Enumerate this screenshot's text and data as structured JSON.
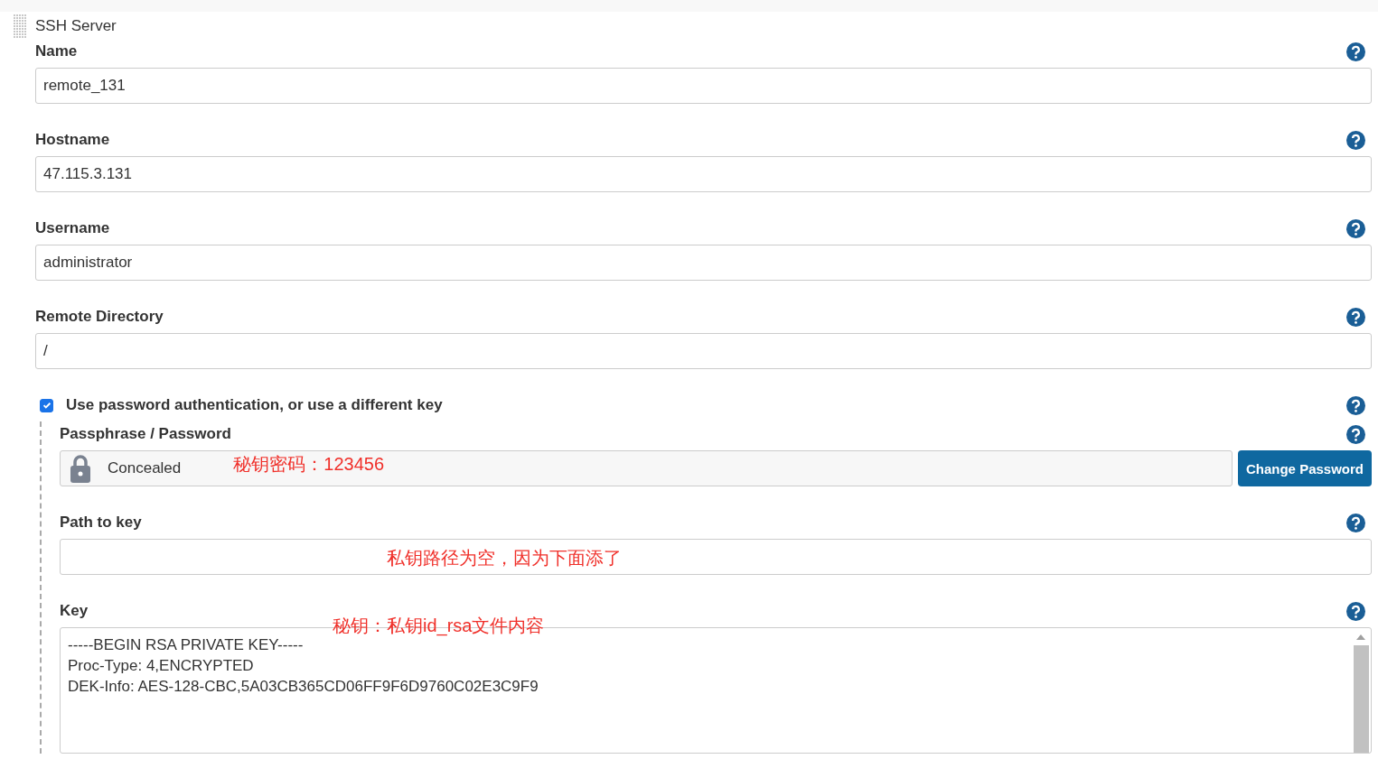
{
  "section": {
    "title": "SSH Server"
  },
  "fields": [
    {
      "label": "Name",
      "value": "remote_131"
    },
    {
      "label": "Hostname",
      "value": "47.115.3.131"
    },
    {
      "label": "Username",
      "value": "administrator"
    },
    {
      "label": "Remote Directory",
      "value": "/"
    }
  ],
  "password_auth": {
    "label": "Use password authentication, or use a different key",
    "checked": true,
    "passphrase": {
      "label": "Passphrase / Password",
      "value": "Concealed",
      "button": "Change Password",
      "annotation": "秘钥密码：123456"
    },
    "path_to_key": {
      "label": "Path to key",
      "annotation": "私钥路径为空，因为下面添了"
    },
    "key": {
      "label": "Key",
      "annotation": "秘钥：私钥id_rsa文件内容",
      "lines": [
        "-----BEGIN RSA PRIVATE KEY-----",
        "Proc-Type: 4,ENCRYPTED",
        "DEK-Info: AES-128-CBC,5A03CB365CD06FF9F6D9760C02E3C9F9"
      ]
    }
  }
}
